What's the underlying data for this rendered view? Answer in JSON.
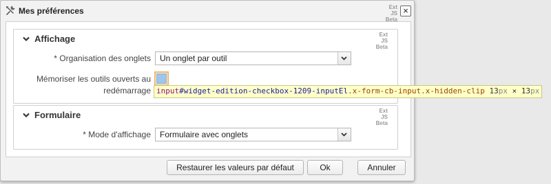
{
  "window": {
    "title": "Mes préférences",
    "icon": "tools-icon",
    "close_label": "×",
    "badge": {
      "line1": "Ext JS",
      "line2": "Beta"
    }
  },
  "display_section": {
    "title": "Affichage",
    "badge": {
      "line1": "Ext JS",
      "line2": "Beta"
    },
    "tab_org": {
      "label": "* Organisation des onglets",
      "value": "Un onglet par outil"
    },
    "remember_tools": {
      "label_line1": "Mémoriser les outils ouverts au",
      "label_line2": "redémarrage",
      "checked": false
    }
  },
  "form_section": {
    "title": "Formulaire",
    "badge": {
      "line1": "Ext JS",
      "line2": "Beta"
    },
    "display_mode": {
      "label": "* Mode d'affichage",
      "value": "Formulaire avec onglets"
    }
  },
  "footer": {
    "reset_label": "Restaurer les valeurs par défaut",
    "ok_label": "Ok",
    "cancel_label": "Annuler"
  },
  "inspector": {
    "tag": "input",
    "id": "#widget-edition-checkbox-1209-inputEl",
    "classes": ".x-form-cb-input.x-hidden-clip",
    "width": "13",
    "height": "13",
    "unit": "px",
    "times": "×"
  }
}
